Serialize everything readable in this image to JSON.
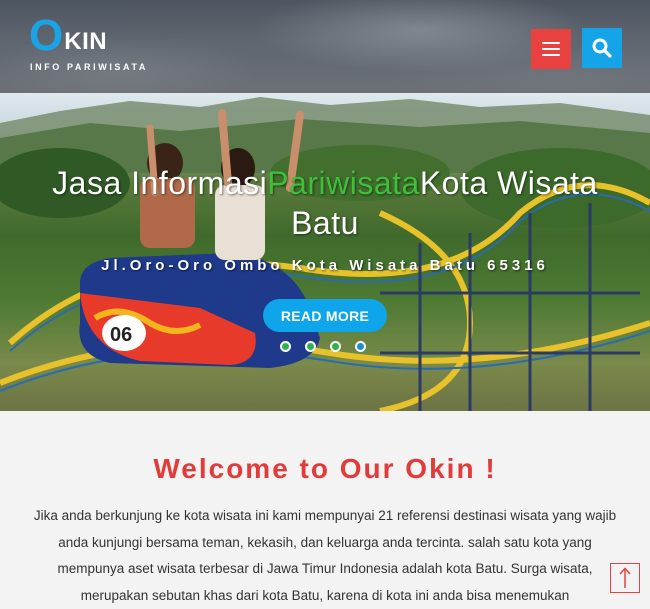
{
  "header": {
    "logo_letter": "O",
    "logo_text": "KIN",
    "logo_subtitle": "INFO PARIWISATA",
    "menu_icon": "hamburger-icon",
    "search_icon": "search-icon"
  },
  "hero": {
    "title_part1": "Jasa Informasi",
    "title_accent": "Pariwisata",
    "title_part2": "Kota Wisata Batu",
    "subtitle": "Jl.Oro-Oro Ombo Kota Wisata Batu 65316",
    "button_label": "READ MORE",
    "slide_count": 4,
    "active_slide": 4
  },
  "welcome": {
    "title": "Welcome to Our Okin !",
    "paragraph": "Jika anda berkunjung ke kota wisata ini kami mempunyai 21 referensi destinasi wisata yang wajib anda kunjungi bersama teman, kekasih, dan keluarga anda tercinta. salah satu kota yang mempunya aset wisata terbesar di Jawa Timur Indonesia adalah kota Batu. Surga wisata, merupakan sebutan khas dari kota Batu, karena di kota ini anda bisa menemukan"
  },
  "colors": {
    "accent_red": "#e8413f",
    "accent_blue": "#16a4e8",
    "accent_green": "#3fbf3a"
  },
  "back_to_top_icon": "arrow-up-icon"
}
